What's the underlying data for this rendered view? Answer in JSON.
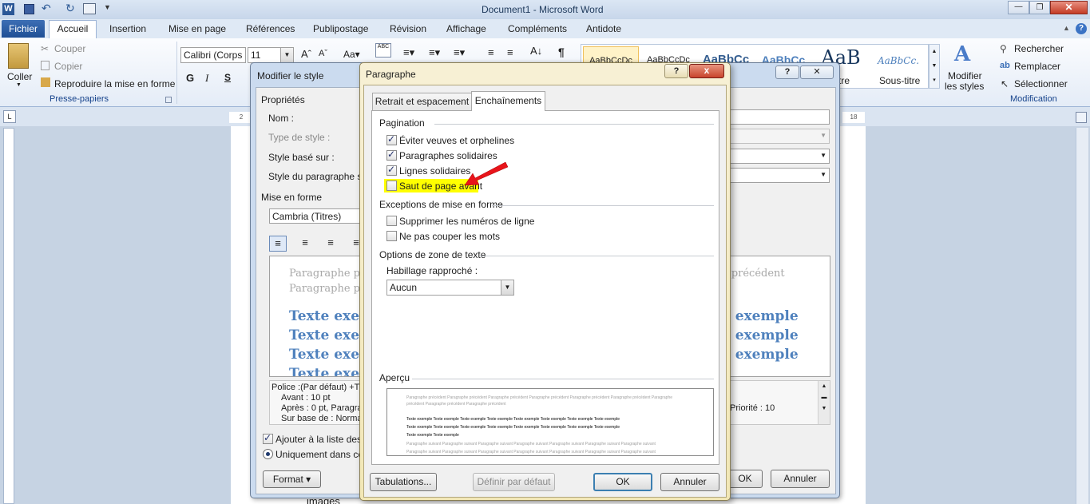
{
  "window": {
    "title": "Document1 - Microsoft Word"
  },
  "ribbon": {
    "file_tab": "Fichier",
    "tabs": [
      "Accueil",
      "Insertion",
      "Mise en page",
      "Références",
      "Publipostage",
      "Révision",
      "Affichage",
      "Compléments",
      "Antidote"
    ],
    "clipboard": {
      "paste": "Coller",
      "cut": "Couper",
      "copy": "Copier",
      "format_painter": "Reproduire la mise en forme",
      "group": "Presse-papiers"
    },
    "font": {
      "name": "Calibri (Corps",
      "size": "11"
    },
    "styles": {
      "thumbs": [
        "AaBbCcDc",
        "AaBbCcDc",
        "AaBbCc",
        "AaBbCc",
        "AaB",
        "AaBbCc."
      ],
      "subtitle": "Sous-titre",
      "title_partial": "tre",
      "modify_line1": "Modifier",
      "modify_line2": "les styles"
    },
    "editing": {
      "find": "Rechercher",
      "replace": "Remplacer",
      "select": "Sélectionner",
      "group": "Modification"
    },
    "ruler": {
      "left": "2",
      "right": "18"
    }
  },
  "modify_style": {
    "title": "Modifier le style",
    "properties": "Propriétés",
    "name_label": "Nom :",
    "type_label": "Type de style :",
    "based_on_label": "Style basé sur :",
    "next_style_label": "Style du paragraphe sui",
    "formatting": "Mise en forme",
    "font_value": "Cambria (Titres)",
    "preview_prev": "Paragraphe préc",
    "preview_prev2": "Paragraphe préc",
    "preview_prev_right": "e précédent",
    "sample_left": "Texte exen",
    "sample_right": "e exemple",
    "desc_line1": "Police :(Par défaut) +Ti",
    "desc_line2": "Avant : 10 pt",
    "desc_line3": "Après : 0 pt, Paragra",
    "desc_line4": "Sur base de : Normal",
    "priority": "Priorité : 10",
    "add_to_list": "Ajouter à la liste des s",
    "only_this_doc": "Uniquement dans ce d",
    "format_button": "Format",
    "ok_partial": "OK",
    "cancel": "Annuler",
    "behind_text": "images"
  },
  "paragraph": {
    "title": "Paragraphe",
    "tabs": [
      "Retrait et espacement",
      "Enchaînements"
    ],
    "pagination_title": "Pagination",
    "widow": "Éviter veuves et orphelines",
    "keep_next": "Paragraphes solidaires",
    "keep_lines": "Lignes solidaires",
    "page_break": "Saut de page avant",
    "exceptions_title": "Exceptions de mise en forme",
    "suppress_numbers": "Supprimer les numéros de ligne",
    "no_hyphen": "Ne pas couper les mots",
    "textbox_title": "Options de zone de texte",
    "tight_wrap_label": "Habillage rapproché :",
    "tight_wrap_value": "Aucun",
    "preview_title": "Aperçu",
    "preview_prev": "Paragraphe précédent Paragraphe précédent Paragraphe précédent Paragraphe précédent Paragraphe précédent Paragraphe précédent Paragraphe",
    "preview_prev2": "précédent Paragraphe précédent Paragraphe précédent",
    "preview_text1": "Texte exemple Texte exemple Texte exemple Texte exemple Texte exemple Texte exemple Texte exemple Texte exemple",
    "preview_text2": "Texte exemple Texte exemple Texte exemple Texte exemple Texte exemple Texte exemple Texte exemple Texte exemple",
    "preview_text3": "Texte exemple Texte exemple",
    "preview_next1": "Paragraphe suivant Paragraphe suivant Paragraphe suivant Paragraphe suivant Paragraphe suivant Paragraphe suivant Paragraphe suivant",
    "preview_next2": "Paragraphe suivant Paragraphe suivant Paragraphe suivant Paragraphe suivant Paragraphe suivant Paragraphe suivant Paragraphe suivant",
    "tabs_button": "Tabulations...",
    "default_button": "Définir par défaut",
    "ok": "OK",
    "cancel": "Annuler",
    "close_glyph": "x",
    "help_glyph": "?"
  },
  "colors": {
    "accent": "#2b579a",
    "highlight": "#ffff00",
    "arrow": "#e8141b"
  }
}
